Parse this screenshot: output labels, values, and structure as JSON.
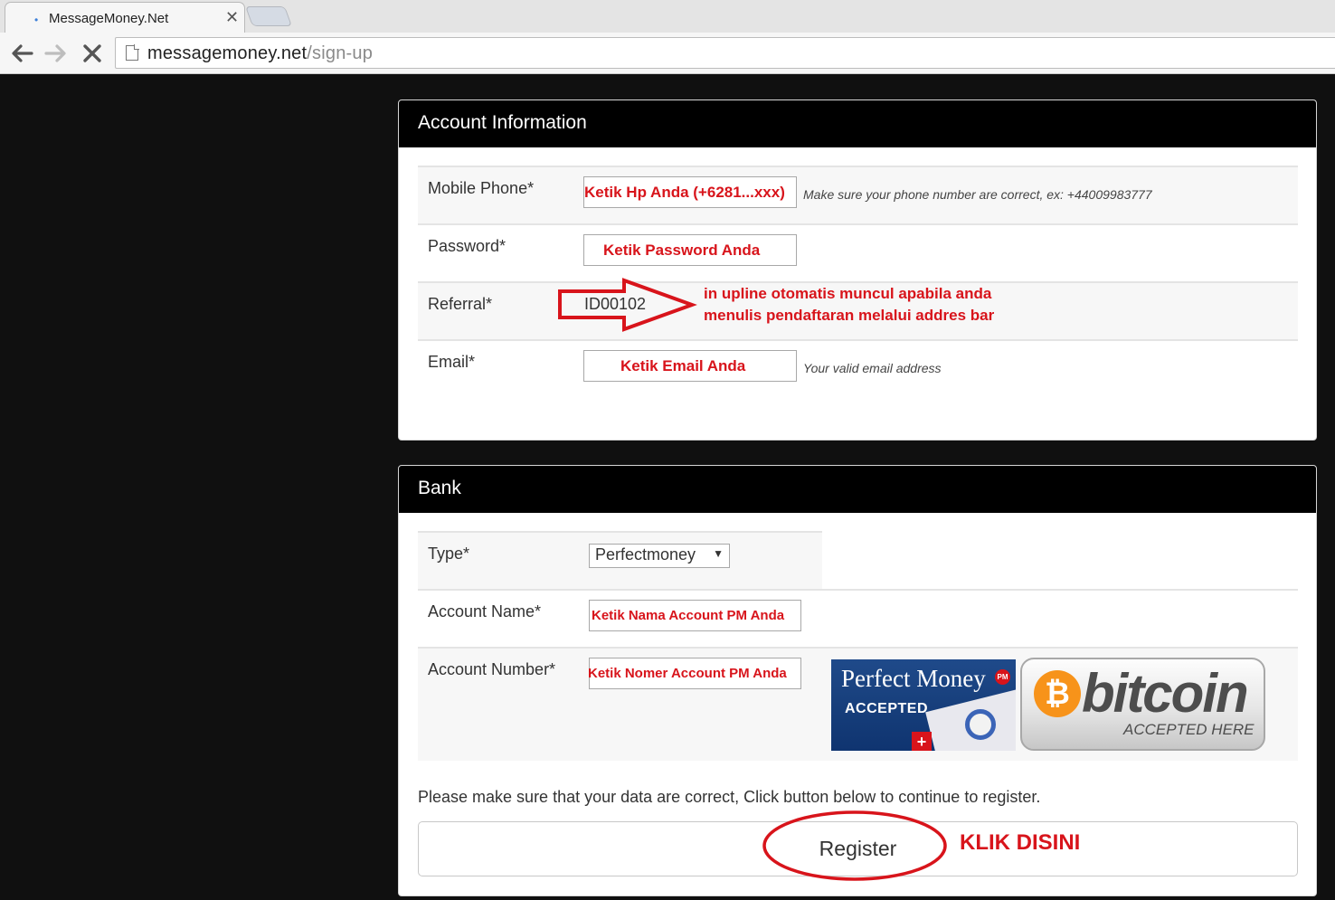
{
  "browser": {
    "tab_title": "MessageMoney.Net",
    "tab_close": "✕",
    "url_host": "messagemoney.net",
    "url_path": "/sign-up"
  },
  "account": {
    "heading": "Account Information",
    "mobile": {
      "label": "Mobile Phone*",
      "value": "Ketik Hp Anda (+6281...xxx)",
      "help": "Make sure your phone number are correct, ex: +44009983777"
    },
    "password": {
      "label": "Password*",
      "value": "Ketik Password Anda"
    },
    "referral": {
      "label": "Referral*",
      "value": "ID00102"
    },
    "email": {
      "label": "Email*",
      "value": "Ketik Email Anda",
      "help": "Your valid email address"
    }
  },
  "bank": {
    "heading": "Bank",
    "type": {
      "label": "Type*",
      "selected": "Perfectmoney",
      "arrow": "▼"
    },
    "account_name": {
      "label": "Account Name*",
      "value": "Ketik Nama Account PM Anda"
    },
    "account_number": {
      "label": "Account Number*",
      "value": "Ketik Nomer Account PM Anda"
    },
    "logos": {
      "perfect_money": {
        "title": "Perfect Money",
        "badge": "PM",
        "subtitle": "ACCEPTED"
      },
      "bitcoin": {
        "symbol": "₿",
        "word": "bitcoin",
        "subtitle": "ACCEPTED HERE"
      }
    },
    "confirm_text": "Please make sure that your data are correct, Click button below to continue to register.",
    "register_label": "Register"
  },
  "annotations": {
    "referral_note_line1": "in upline otomatis muncul apabila anda",
    "referral_note_line2": "menulis pendaftaran melalui addres bar",
    "register_note": "KLIK DISINI"
  },
  "colors": {
    "annotation_red": "#d8141b",
    "panel_header": "#000000",
    "page_background": "#101010"
  }
}
